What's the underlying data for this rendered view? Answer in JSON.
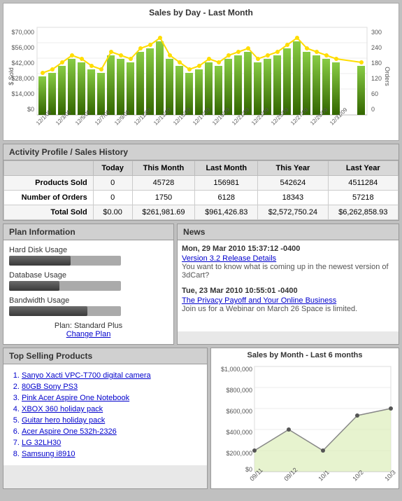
{
  "chart": {
    "title": "Sales by Day - Last Month",
    "y_axis_left_label": "$ Sold",
    "y_axis_right_label": "Orders",
    "left_ticks": [
      "$70,000",
      "$56,000",
      "$42,000",
      "$28,000",
      "$14,000",
      "$0"
    ],
    "right_ticks": [
      "300",
      "240",
      "180",
      "120",
      "60",
      "0"
    ],
    "x_labels": [
      "12/1/09",
      "12/3/09",
      "12/5/09",
      "12/7/09",
      "12/9/09",
      "12/11/09",
      "12/13/09",
      "12/15/09",
      "12/17/09",
      "12/19/09",
      "12/21/09",
      "12/23/09",
      "12/25/09",
      "12/27/09",
      "12/29/09",
      "12/31/09"
    ]
  },
  "activity": {
    "header": "Activity Profile / Sales History",
    "columns": [
      "Today",
      "This Month",
      "Last Month",
      "This Year",
      "Last Year"
    ],
    "rows": [
      {
        "label": "Products Sold",
        "values": [
          "0",
          "45728",
          "156981",
          "542624",
          "4511284"
        ]
      },
      {
        "label": "Number of Orders",
        "values": [
          "0",
          "1750",
          "6128",
          "18343",
          "57218"
        ]
      },
      {
        "label": "Total Sold",
        "values": [
          "$0.00",
          "$261,981.69",
          "$961,426.83",
          "$2,572,750.24",
          "$6,262,858.93"
        ]
      }
    ]
  },
  "plan": {
    "header": "Plan Information",
    "items": [
      {
        "label": "Hard Disk Usage",
        "fill": 55
      },
      {
        "label": "Database Usage",
        "fill": 45
      },
      {
        "label": "Bandwidth Usage",
        "fill": 70
      }
    ],
    "plan_name": "Plan: Standard Plus",
    "change_label": "Change Plan"
  },
  "news": {
    "header": "News",
    "items": [
      {
        "date": "Mon, 29 Mar 2010 15:37:12 -0400",
        "link_text": "Version 3.2 Release Details",
        "body": "You want to know what is coming up in the newest version of 3dCart?"
      },
      {
        "date": "Tue, 23 Mar 2010 10:55:01 -0400",
        "link_text": "The Privacy Payoff and Your Online Business",
        "body": "Join us for a Webinar on March 26 Space is limited."
      }
    ]
  },
  "top_products": {
    "header": "Top Selling Products",
    "items": [
      "Sanyo Xacti VPC-T700 digital camera",
      "80GB Sony PS3",
      "Pink Acer Aspire One Notebook",
      "XBOX 360 holiday pack",
      "Guitar hero holiday pack",
      "Acer Aspire One 532h-2326",
      "LG 32LH30",
      "Samsung i8910"
    ]
  },
  "monthly_chart": {
    "title": "Sales by Month - Last 6 months",
    "y_ticks": [
      "$1,000,000",
      "$800,000",
      "$600,000",
      "$400,000",
      "$200,000",
      "$0"
    ],
    "x_labels": [
      "09/11",
      "09/12",
      "10/1",
      "10/2",
      "10/3"
    ]
  }
}
